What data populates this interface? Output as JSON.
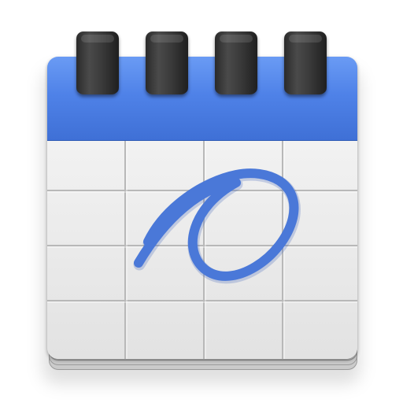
{
  "app": {
    "icon": "calendar-app-icon"
  },
  "colors": {
    "header_blue": "#4f82e8",
    "scribble_blue": "#4a78d8",
    "grid_line": "#b8b8b8",
    "ring_dark": "#2a2a2a"
  },
  "icons": {
    "binder_ring": "binder-ring-icon",
    "scribble_mark": "scribble-mark-icon"
  }
}
